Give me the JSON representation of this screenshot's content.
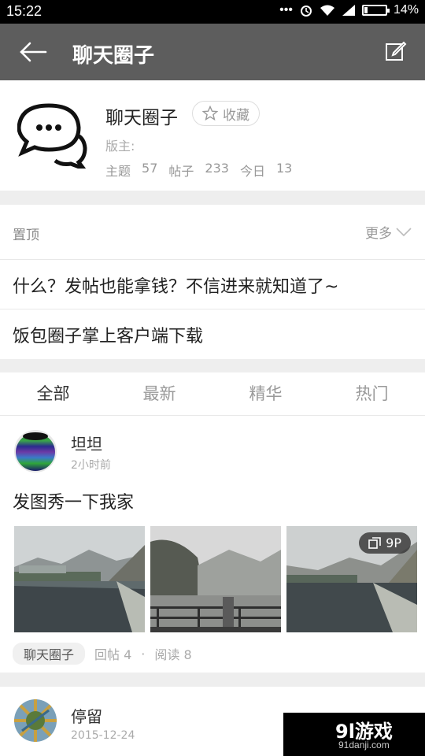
{
  "status_bar": {
    "time": "15:22",
    "battery": "14%",
    "battery_level": 0.14
  },
  "app_bar": {
    "title": "聊天圈子"
  },
  "group": {
    "name": "聊天圈子",
    "favorite_label": "收藏",
    "moderator_label": "版主:",
    "stats": [
      {
        "label": "主题",
        "value": "57"
      },
      {
        "label": "帖子",
        "value": "233"
      },
      {
        "label": "今日",
        "value": "13"
      }
    ]
  },
  "pinned": {
    "label": "置顶",
    "more_label": "更多",
    "items": [
      "什么？发帖也能拿钱？不信进来就知道了~",
      "饭包圈子掌上客户端下载"
    ]
  },
  "tabs": [
    "全部",
    "最新",
    "精华",
    "热门"
  ],
  "active_tab": "全部",
  "posts": [
    {
      "author": "坦坦",
      "time": "2小时前",
      "title": "发图秀一下我家",
      "image_count_badge": "9P",
      "tag": "聊天圈子",
      "replies": "回帖 4",
      "separator": "·",
      "views": "阅读 8"
    },
    {
      "author": "停留",
      "time": "2015-12-24"
    }
  ],
  "watermark": {
    "main": "9l游戏",
    "sub": "91danji.com"
  },
  "colors": {
    "app_bar": "#5d5d5d",
    "background": "#eeeeee",
    "card": "#ffffff"
  }
}
